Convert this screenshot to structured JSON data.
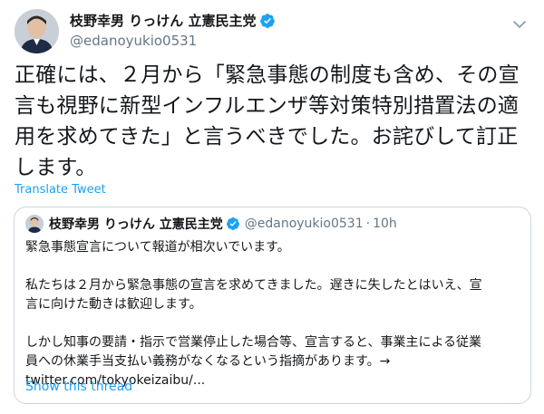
{
  "author": {
    "display_name": "枝野幸男 りっけん 立憲民主党",
    "handle": "@edanoyukio0531"
  },
  "tweet": {
    "lines": [
      "正確には、２月から「緊急事態の制度も含め、その宣",
      "言も視野に新型インフルエンザ等対策特別措置法の適",
      "用を求めてきた」と言うべきでした。お詫びして訂正",
      "します。"
    ],
    "translate_label": "Translate Tweet"
  },
  "quoted": {
    "display_name": "枝野幸男 りっけん 立憲民主党",
    "handle": "@edanoyukio0531",
    "separator": "·",
    "time": "10h",
    "lines": [
      "緊急事態宣言について報道が相次いでいます。",
      "",
      "私たちは２月から緊急事態の宣言を求めてきました。遅きに失したとはいえ、宣",
      "言に向けた動きは歓迎します。",
      "",
      "しかし知事の要請・指示で営業停止した場合等、宣言すると、事業主による従業",
      "員への休業手当支払い義務がなくなるという指摘があります。→",
      "twitter.com/tokyokeizaibu/..."
    ],
    "show_thread_label": "Show this thread"
  },
  "icons": {
    "verified": "verified-badge-icon",
    "caret": "chevron-down-icon"
  },
  "colors": {
    "link_blue": "#1da1f2",
    "verified_blue": "#1da1f2",
    "secondary_text": "#657786",
    "border": "#ccd6dd"
  }
}
